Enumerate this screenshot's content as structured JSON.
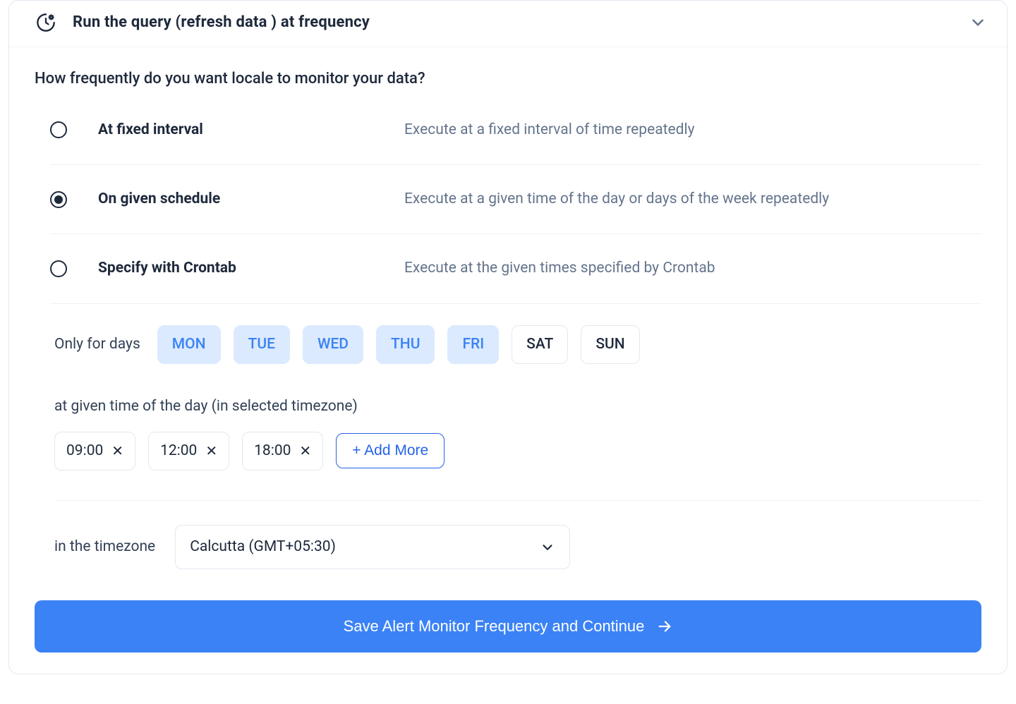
{
  "header": {
    "title": "Run the query (refresh data ) at frequency"
  },
  "question": "How frequently do you want locale to monitor your data?",
  "options": [
    {
      "id": "fixed",
      "label": "At fixed interval",
      "desc": "Execute at a fixed interval of time repeatedly",
      "selected": false
    },
    {
      "id": "schedule",
      "label": "On given schedule",
      "desc": "Execute at a given time of the day or days of the week repeatedly",
      "selected": true
    },
    {
      "id": "crontab",
      "label": "Specify with Crontab",
      "desc": "Execute at the given times specified by Crontab",
      "selected": false
    }
  ],
  "days": {
    "label": "Only for days",
    "items": [
      {
        "code": "MON",
        "selected": true
      },
      {
        "code": "TUE",
        "selected": true
      },
      {
        "code": "WED",
        "selected": true
      },
      {
        "code": "THU",
        "selected": true
      },
      {
        "code": "FRI",
        "selected": true
      },
      {
        "code": "SAT",
        "selected": false
      },
      {
        "code": "SUN",
        "selected": false
      }
    ]
  },
  "times": {
    "label": "at given time of the day (in selected timezone)",
    "items": [
      "09:00",
      "12:00",
      "18:00"
    ],
    "add_label": "+ Add More"
  },
  "timezone": {
    "label": "in the timezone",
    "value": "Calcutta (GMT+05:30)"
  },
  "cta": "Save Alert Monitor Frequency and Continue"
}
